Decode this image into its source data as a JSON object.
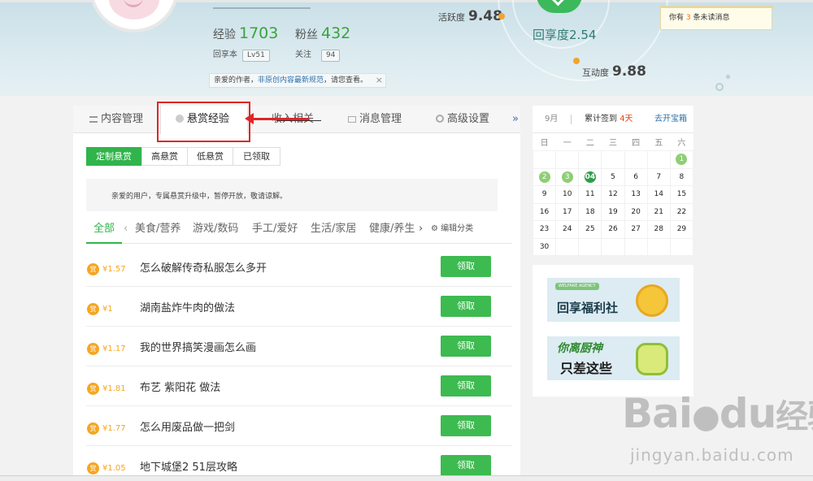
{
  "header": {
    "stats": {
      "exp_label": "经验",
      "exp_value": "1703",
      "fans_label": "粉丝",
      "fans_value": "432",
      "share_label": "回享本",
      "share_badge": "Lv51",
      "follow_label": "关注",
      "follow_badge": "94"
    },
    "notice": {
      "prefix": "亲爱的作者，",
      "link": "非原创内容最新规范",
      "suffix": "，请您查看。",
      "close": "×"
    },
    "metrics": {
      "activity_label": "活跃度",
      "activity_value": "9.48",
      "share_label": "回享度",
      "share_value": "2.54",
      "interact_label": "互动度",
      "interact_value": "9.88"
    },
    "message": {
      "prefix": "你有",
      "count": "3",
      "suffix": "条未读消息"
    }
  },
  "tabs": [
    {
      "label": "内容管理",
      "icon": "list-icon"
    },
    {
      "label": "悬赏经验",
      "icon": "coin-icon"
    },
    {
      "label": "收入相关",
      "icon": "money-icon"
    },
    {
      "label": "消息管理",
      "icon": "mail-icon"
    },
    {
      "label": "高级设置",
      "icon": "gear-icon"
    }
  ],
  "tab_more": "»",
  "subtabs": [
    "定制悬赏",
    "高悬赏",
    "低悬赏",
    "已领取"
  ],
  "info_text": "亲爱的用户，专属悬赏升级中，暂停开放，敬请谅解。",
  "categories": [
    "全部",
    "美食/营养",
    "游戏/数码",
    "手工/爱好",
    "生活/家居",
    "健康/养生"
  ],
  "cat_prev": "‹",
  "cat_next": "›",
  "edit_categories": "编辑分类",
  "questions": [
    {
      "coin": "赏",
      "reward": "¥1.57",
      "title": "怎么破解传奇私服怎么多开",
      "action": "领取"
    },
    {
      "coin": "赏",
      "reward": "¥1",
      "title": "湖南盐炸牛肉的做法",
      "action": "领取"
    },
    {
      "coin": "赏",
      "reward": "¥1.17",
      "title": "我的世界搞笑漫画怎么画",
      "action": "领取"
    },
    {
      "coin": "赏",
      "reward": "¥1.81",
      "title": "布艺 紫阳花 做法",
      "action": "领取"
    },
    {
      "coin": "赏",
      "reward": "¥1.77",
      "title": "怎么用废品做一把剑",
      "action": "领取"
    },
    {
      "coin": "赏",
      "reward": "¥1.05",
      "title": "地下城堡2 51层攻略",
      "action": "领取"
    }
  ],
  "calendar": {
    "month": "9月",
    "signin_prefix": "累计签到",
    "signin_days": "4天",
    "link": "去开宝箱",
    "weekdays": [
      "日",
      "一",
      "二",
      "三",
      "四",
      "五",
      "六"
    ],
    "weeks": [
      [
        "",
        "",
        "",
        "",
        "",
        "",
        "1"
      ],
      [
        "2",
        "3",
        "04",
        "5",
        "6",
        "7",
        "8"
      ],
      [
        "9",
        "10",
        "11",
        "12",
        "13",
        "14",
        "15"
      ],
      [
        "16",
        "17",
        "18",
        "19",
        "20",
        "21",
        "22"
      ],
      [
        "23",
        "24",
        "25",
        "26",
        "27",
        "28",
        "29"
      ],
      [
        "30",
        "",
        "",
        "",
        "",
        "",
        ""
      ]
    ],
    "signed": [
      "1",
      "2",
      "3"
    ],
    "today": "04"
  },
  "ads": [
    {
      "tag": "WELFARE AGENCY",
      "title": "回享福利社"
    },
    {
      "title1": "你离厨神",
      "title2": "只差这些"
    }
  ],
  "watermark": {
    "brand": "Bai",
    "brand2": "du",
    "name": "经验",
    "url": "jingyan.baidu.com"
  }
}
